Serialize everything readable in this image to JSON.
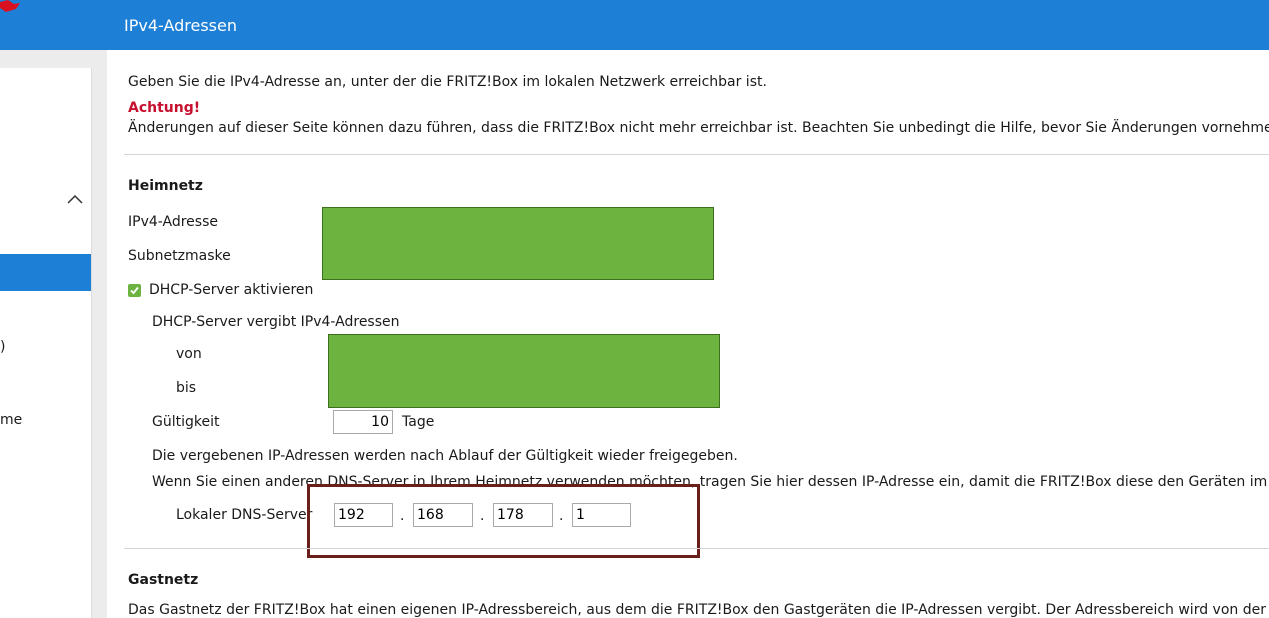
{
  "header": {
    "title": "IPv4-Adressen"
  },
  "sidebar": {
    "fragments": [
      ")",
      "me"
    ]
  },
  "intro": {
    "text": "Geben Sie die IPv4-Adresse an, unter der die FRITZ!Box im lokalen Netzwerk erreichbar ist.",
    "warning_title": "Achtung!",
    "warning_text": "Änderungen auf dieser Seite können dazu führen, dass die FRITZ!Box nicht mehr erreichbar ist. Beachten Sie unbedingt die Hilfe, bevor Sie Änderungen vornehmen."
  },
  "heimnetz": {
    "title": "Heimnetz",
    "ipv4_label": "IPv4-Adresse",
    "subnet_label": "Subnetzmaske",
    "dhcp_checkbox_label": "DHCP-Server aktivieren",
    "dhcp_checked": true,
    "dhcp_range_label": "DHCP-Server vergibt IPv4-Adressen",
    "von_label": "von",
    "bis_label": "bis",
    "validity_label": "Gültigkeit",
    "validity_value": "10",
    "validity_unit": "Tage",
    "release_note": "Die vergebenen IP-Adressen werden nach Ablauf der Gültigkeit wieder freigegeben.",
    "dns_note": "Wenn Sie einen anderen DNS-Server in Ihrem Heimnetz verwenden möchten, tragen Sie hier dessen IP-Adresse ein, damit die FRITZ!Box diese den Geräten im Heimnetz b",
    "dns_label": "Lokaler DNS-Server",
    "dns_octets": [
      "192",
      "168",
      "178",
      "1"
    ],
    "dot": "."
  },
  "gastnetz": {
    "title": "Gastnetz",
    "text": "Das Gastnetz der FRITZ!Box hat einen eigenen IP-Adressbereich, aus dem die FRITZ!Box den Gastgeräten die IP-Adressen vergibt. Der Adressbereich wird von der FRITZ!Box fe"
  },
  "colors": {
    "accent": "#1e7fd6",
    "warning": "#c8102e",
    "redacted": "#6db33f",
    "highlight": "#6b1f1a"
  }
}
